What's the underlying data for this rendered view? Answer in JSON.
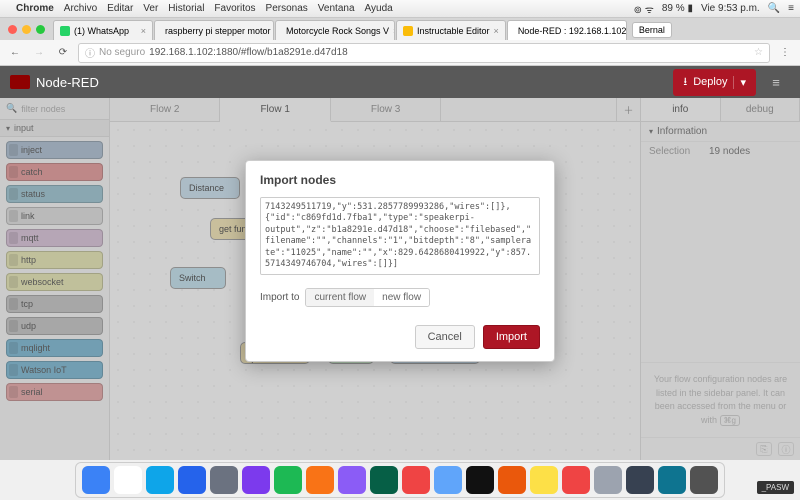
{
  "mac": {
    "app": "Chrome",
    "menus": [
      "Archivo",
      "Editar",
      "Ver",
      "Historial",
      "Favoritos",
      "Personas",
      "Ventana",
      "Ayuda"
    ],
    "battery": "89 %",
    "clock": "Vie 9:53 p.m."
  },
  "chrome": {
    "tabs": [
      {
        "label": "(1) WhatsApp",
        "favColor": "#25d366"
      },
      {
        "label": "raspberry pi stepper motor p",
        "favColor": "#24292e"
      },
      {
        "label": "Motorcycle Rock Songs V",
        "favColor": "#ff0000"
      },
      {
        "label": "Instructable Editor",
        "favColor": "#fabc09"
      },
      {
        "label": "Node-RED : 192.168.1.102",
        "favColor": "#8f0000",
        "active": true
      }
    ],
    "user": "Bernal",
    "security": "No seguro",
    "url": "192.168.1.102:1880/#flow/b1a8291e.d47d18"
  },
  "nodered": {
    "title": "Node-RED",
    "deploy": "Deploy",
    "palette": {
      "filter_placeholder": "filter nodes",
      "category": "input",
      "items": [
        {
          "label": "inject",
          "color": "#a6bbcf"
        },
        {
          "label": "catch",
          "color": "#e49191"
        },
        {
          "label": "status",
          "color": "#94c1d0"
        },
        {
          "label": "link",
          "color": "#dddddd"
        },
        {
          "label": "mqtt",
          "color": "#d8bfd8"
        },
        {
          "label": "http",
          "color": "#e7e7ae"
        },
        {
          "label": "websocket",
          "color": "#e7e7ae"
        },
        {
          "label": "tcp",
          "color": "#c0c0c0"
        },
        {
          "label": "udp",
          "color": "#c0c0c0"
        },
        {
          "label": "mqlight",
          "color": "#6fb3d2"
        },
        {
          "label": "Watson IoT",
          "color": "#6fb3d2"
        },
        {
          "label": "serial",
          "color": "#e7a0a0"
        }
      ]
    },
    "ws_tabs": [
      "Flow 2",
      "Flow 1",
      "Flow 3"
    ],
    "ws_active": 1,
    "sidebar": {
      "tabs": [
        "info",
        "debug"
      ],
      "active": 0,
      "section": "Information",
      "selection_label": "Selection",
      "selection_value": "19 nodes",
      "hint": "Your flow configuration nodes are listed in the sidebar panel. It can been accessed from the menu or with",
      "hint_kbd": "⌘g"
    },
    "dialog": {
      "title": "Import nodes",
      "text": "7143249511719,\"y\":531.2857789993286,\"wires\":[]},{\"id\":\"c869fd1d.7fba1\",\"type\":\"speakerpi-output\",\"z\":\"b1a8291e.d47d18\",\"choose\":\"filebased\",\"filename\":\"\",\"channels\":\"1\",\"bitdepth\":\"8\",\"samplerate\":\"11025\",\"name\":\"\",\"x\":829.6428680419922,\"y\":857.5714349746704,\"wires\":[]}]",
      "import_to_label": "Import to",
      "opt_current": "current flow",
      "opt_new": "new flow",
      "cancel": "Cancel",
      "import": "Import"
    }
  },
  "dock_colors": [
    "#3b82f6",
    "#ffffff",
    "#0ea5e9",
    "#2563eb",
    "#6b7280",
    "#7c3aed",
    "#1db954",
    "#f97316",
    "#8b5cf6",
    "#065f46",
    "#ef4444",
    "#60a5fa",
    "#111111",
    "#ea580c",
    "#fde047",
    "#ef4444",
    "#9ca3af",
    "#374151",
    "#0e7490",
    "#525252"
  ],
  "watermark": "_PASW"
}
